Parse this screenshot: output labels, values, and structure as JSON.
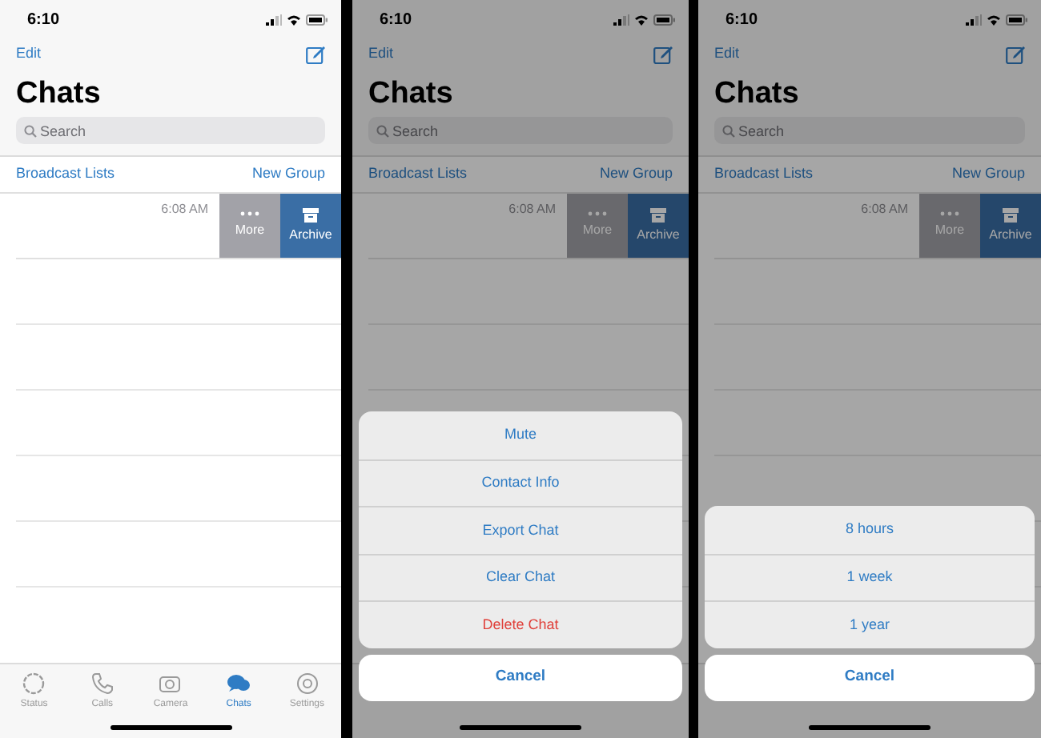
{
  "panels": [
    {
      "status_time": "6:10",
      "edit": "Edit",
      "title": "Chats",
      "search": {
        "placeholder": "Search"
      },
      "broadcast": "Broadcast Lists",
      "new_group": "New Group",
      "chat_time": "6:08 AM",
      "swipe_actions": [
        {
          "label": "More",
          "kind": "more"
        },
        {
          "label": "Archive",
          "kind": "archive"
        }
      ],
      "dimmed": false,
      "tabs": [
        {
          "label": "Status",
          "kind": "status",
          "selected": false
        },
        {
          "label": "Calls",
          "kind": "calls",
          "selected": false
        },
        {
          "label": "Camera",
          "kind": "camera",
          "selected": false
        },
        {
          "label": "Chats",
          "kind": "chats",
          "selected": true
        },
        {
          "label": "Settings",
          "kind": "settings",
          "selected": false
        }
      ]
    },
    {
      "status_time": "6:10",
      "edit": "Edit",
      "title": "Chats",
      "search": {
        "placeholder": "Search"
      },
      "broadcast": "Broadcast Lists",
      "new_group": "New Group",
      "chat_time": "6:08 AM",
      "swipe_actions": [
        {
          "label": "More",
          "kind": "more"
        },
        {
          "label": "Archive",
          "kind": "archive"
        }
      ],
      "dimmed": true,
      "action_sheet": {
        "items": [
          {
            "label": "Mute",
            "kind": "default"
          },
          {
            "label": "Contact Info",
            "kind": "default"
          },
          {
            "label": "Export Chat",
            "kind": "default"
          },
          {
            "label": "Clear Chat",
            "kind": "default"
          },
          {
            "label": "Delete Chat",
            "kind": "destructive"
          }
        ],
        "cancel": "Cancel"
      }
    },
    {
      "status_time": "6:10",
      "edit": "Edit",
      "title": "Chats",
      "search": {
        "placeholder": "Search"
      },
      "broadcast": "Broadcast Lists",
      "new_group": "New Group",
      "chat_time": "6:08 AM",
      "swipe_actions": [
        {
          "label": "More",
          "kind": "more"
        },
        {
          "label": "Archive",
          "kind": "archive"
        }
      ],
      "dimmed": true,
      "action_sheet": {
        "items": [
          {
            "label": "8 hours",
            "kind": "default"
          },
          {
            "label": "1 week",
            "kind": "default"
          },
          {
            "label": "1 year",
            "kind": "default"
          }
        ],
        "cancel": "Cancel"
      }
    }
  ]
}
